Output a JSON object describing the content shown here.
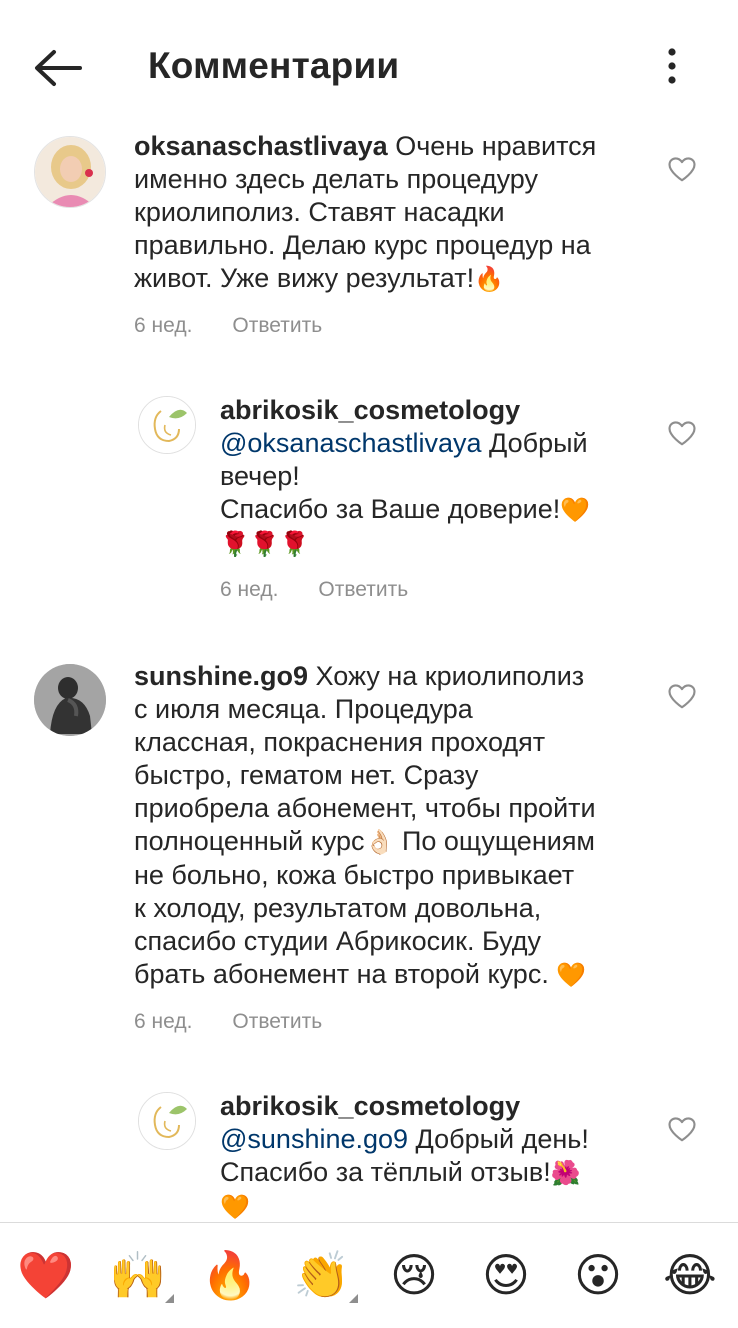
{
  "header": {
    "title": "Комментарии"
  },
  "comments": [
    {
      "username": "oksanaschastlivaya",
      "text": "Очень нравится\nименно здесь делать процедуру\nкриолиполиз. Ставят насадки\nправильно. Делаю курс процедур на\nживот. Уже вижу результат!",
      "emoji": "🔥",
      "time": "6 нед.",
      "reply_label": "Ответить"
    },
    {
      "username": "abrikosik_cosmetology",
      "mention": "@oksanaschastlivaya",
      "text": " Добрый\nвечер!\nСпасибо за Ваше доверие!",
      "emoji": "🧡",
      "emoji_line": "🌹🌹🌹",
      "time": "6 нед.",
      "reply_label": "Ответить"
    },
    {
      "username": "sunshine.go9",
      "text": "Хожу на криолиполиз\nс июля месяца. Процедура\nклассная, покраснения проходят\nбыстро, гематом нет. Сразу\nприобрела абонемент, чтобы пройти\nполноценный курс",
      "emoji": "👌🏻",
      "text2": " По ощущениям\nне больно, кожа быстро привыкает\nк холоду, результатом довольна,\nспасибо студии Абрикосик. Буду\nбрать абонемент на второй курс. ",
      "emoji2": "🧡",
      "time": "6 нед.",
      "reply_label": "Ответить"
    },
    {
      "username": "abrikosik_cosmetology",
      "mention": "@sunshine.go9",
      "text": " Добрый день!\nСпасибо за тёплый отзыв!",
      "emoji": "🌺",
      "emoji_line": "🧡"
    }
  ],
  "reactions": [
    {
      "name": "red-heart",
      "glyph": "❤️",
      "has_variants": false
    },
    {
      "name": "raising-hands",
      "glyph": "🙌",
      "has_variants": true
    },
    {
      "name": "fire",
      "glyph": "🔥",
      "has_variants": false
    },
    {
      "name": "clapping-hands",
      "glyph": "👏",
      "has_variants": true
    },
    {
      "name": "crying-face",
      "glyph": "😢",
      "has_variants": false
    },
    {
      "name": "heart-eyes",
      "glyph": "😍",
      "has_variants": false
    },
    {
      "name": "surprised-face",
      "glyph": "😮",
      "has_variants": false
    },
    {
      "name": "tears-of-joy",
      "glyph": "😂",
      "has_variants": false
    }
  ],
  "colors": {
    "text": "#262626",
    "meta": "#8e8e8e",
    "mention": "#00376b",
    "divider": "#dbdbdb"
  }
}
